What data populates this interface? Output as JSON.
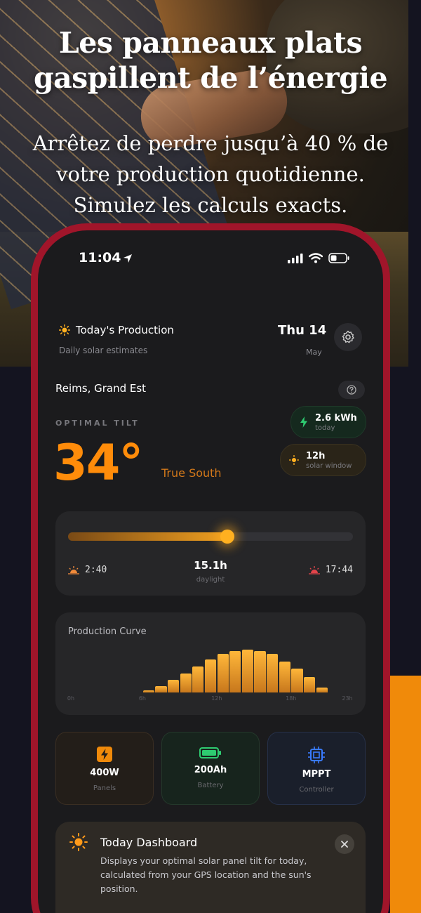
{
  "hero": {
    "headline_line1": "Les panneaux plats",
    "headline_line2": "gaspillent de l’énergie",
    "sub_line1": "Arrêtez de perdre jusqu’à 40 % de",
    "sub_line2": "votre production quotidienne.",
    "sub_line3": "Simulez les calculs exacts."
  },
  "status_bar": {
    "time": "11:04"
  },
  "header": {
    "title": "Today's Production",
    "subtitle": "Daily solar estimates",
    "date": "Thu 14",
    "month": "May"
  },
  "location": "Reims, Grand Est",
  "tilt": {
    "label": "OPTIMAL TILT",
    "value": "34°",
    "direction": "True South"
  },
  "stats": {
    "energy_value": "2.6 kWh",
    "energy_label": "today",
    "window_value": "12h",
    "window_label": "solar window"
  },
  "sun": {
    "sunrise": "2:40",
    "sunset": "17:44",
    "daylight_value": "15.1h",
    "daylight_label": "daylight",
    "progress": 0.56
  },
  "chart_data": {
    "type": "bar",
    "title": "Production Curve",
    "x_ticks": [
      "0h",
      "6h",
      "12h",
      "18h",
      "23h"
    ],
    "categories": [
      "6h",
      "7h",
      "8h",
      "9h",
      "10h",
      "11h",
      "12h",
      "13h",
      "14h",
      "15h",
      "16h",
      "17h",
      "18h",
      "19h",
      "20h"
    ],
    "values": [
      0.04,
      0.12,
      0.24,
      0.36,
      0.5,
      0.64,
      0.74,
      0.8,
      0.82,
      0.8,
      0.74,
      0.6,
      0.46,
      0.3,
      0.1
    ],
    "ylim": [
      0,
      1
    ]
  },
  "specs": {
    "panels_value": "400W",
    "panels_label": "Panels",
    "battery_value": "200Ah",
    "battery_label": "Battery",
    "controller_value": "MPPT",
    "controller_label": "Controller"
  },
  "dashboard": {
    "title": "Today Dashboard",
    "text": "Displays your optimal solar panel tilt for today, calculated from your GPS location and the sun's position."
  },
  "colors": {
    "accent": "#ff8c0a",
    "phone_frame": "#a0152a",
    "screen_bg": "#1b1b1d",
    "energy_green": "#2ecc71",
    "controller_blue": "#3a7bff"
  }
}
